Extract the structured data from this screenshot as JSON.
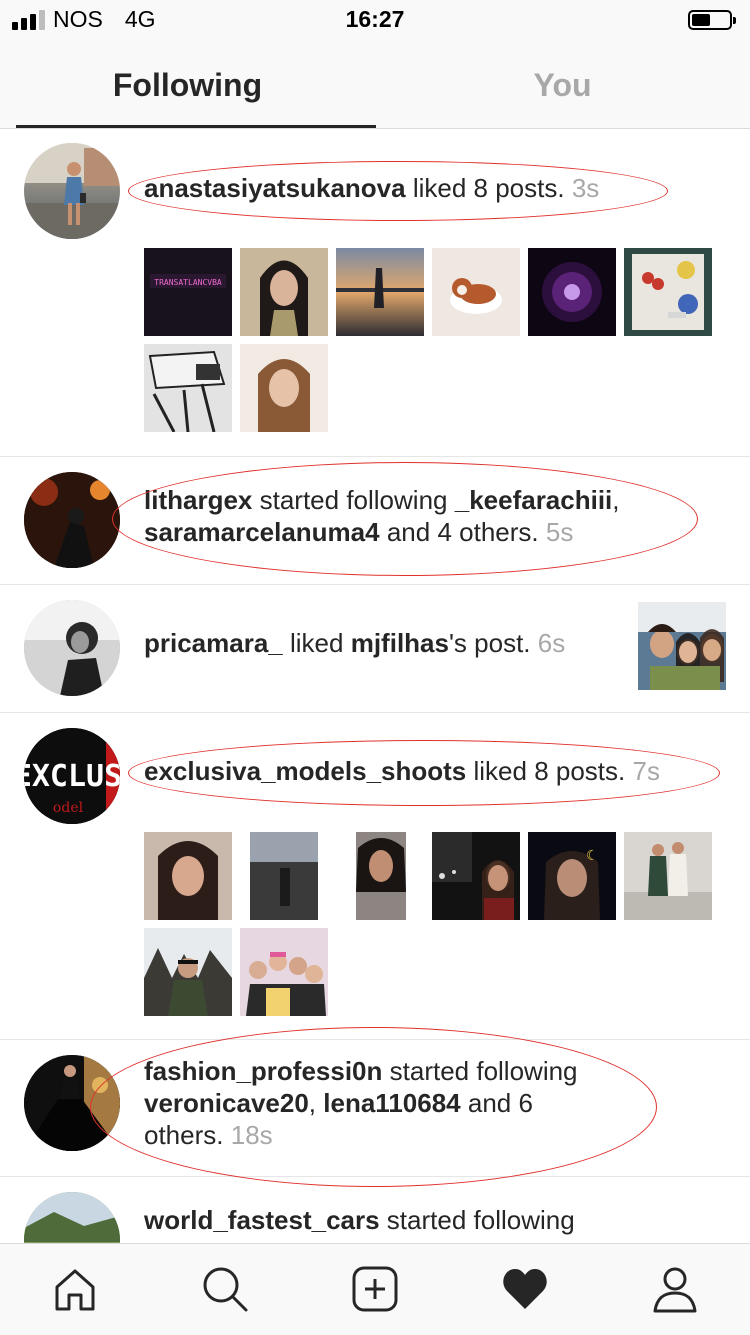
{
  "status_bar": {
    "carrier": "NOS",
    "network": "4G",
    "time": "16:27"
  },
  "tabs": [
    {
      "label": "Following",
      "active": true
    },
    {
      "label": "You",
      "active": false
    }
  ],
  "feed": [
    {
      "user": "anastasiyatsukanova",
      "action": "liked 8 posts.",
      "time": "3s",
      "thumbnails": [
        "dark room with neon sign",
        "woman with long dark hair",
        "sunset lake silhouette",
        "puppy on blanket",
        "dark purple light",
        "food table with paint",
        "pencil sketch",
        "portrait of woman"
      ],
      "circled": true
    },
    {
      "user": "lithargex",
      "action1": "started following",
      "target1": "_keefarachiii",
      "sep": ",",
      "target2": "saramarcelanuma4",
      "action2": "and 4 others.",
      "time": "5s",
      "circled": true
    },
    {
      "user": "pricamara_",
      "action1": "liked",
      "target": "mjfilhas",
      "action2": "'s post.",
      "time": "6s",
      "post_image": "group selfie"
    },
    {
      "user": "exclusiva_models_shoots",
      "action": "liked 8 posts.",
      "time": "7s",
      "avatar_text": "EXCLUS",
      "avatar_subtext": "odel",
      "thumbnails": [
        "woman selfie",
        "person at dusk",
        "woman in grey top",
        "woman in dark car",
        "woman with crown sticker",
        "two women posing",
        "man in snowy forest",
        "group of friends"
      ],
      "circled": true
    },
    {
      "user": "fashion_professi0n",
      "action1": "started following",
      "target1": "veronicave20",
      "sep": ",",
      "target2": "lena110684",
      "action2": "and 6",
      "action3": "others.",
      "time": "18s",
      "circled": true
    },
    {
      "user": "world_fastest_cars",
      "action": "started following"
    }
  ],
  "nav": [
    {
      "icon": "home-icon"
    },
    {
      "icon": "search-icon"
    },
    {
      "icon": "add-post-icon"
    },
    {
      "icon": "activity-heart-icon",
      "active": true
    },
    {
      "icon": "profile-icon"
    }
  ],
  "colors": {
    "annotation": "#e0312c",
    "text": "#262626",
    "muted": "#a8a8a8",
    "divider": "#e6e6e6"
  }
}
